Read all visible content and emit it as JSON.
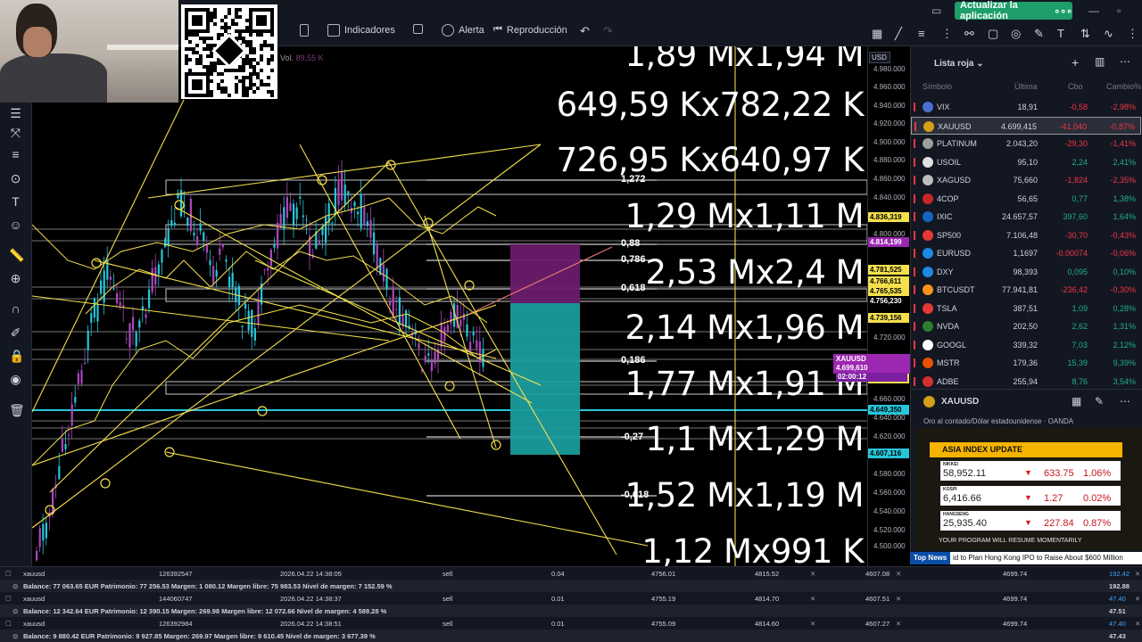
{
  "toolbar": {
    "indicators_label": "Indicadores",
    "alert_label": "Alerta",
    "replay_label": "Reproducción",
    "update_app_label": "Actualizar la aplicación"
  },
  "chart": {
    "volume_label": "Vol.",
    "volume_value": "89,55 K",
    "currency": "USD",
    "ratio_labels": [
      "1,89 Mx1,94 M",
      "649,59 Kx782,22 K",
      "726,95 Kx640,97 K",
      "1,29 Mx1,11 M",
      "2,53 Mx2,4 M",
      "2,14 Mx1,96 M",
      "1,77 Mx1,91 M",
      "1,1 Mx1,29 M",
      "1,52 Mx1,19 M",
      "1,12 Mx991 K"
    ],
    "fib_levels": [
      "1,272",
      "0,88",
      "0,786",
      "0,618",
      "0,186",
      "-0,27",
      "-0,618"
    ],
    "price_ticks": [
      "4.980.000",
      "4.960.000",
      "4.940.000",
      "4.920.000",
      "4.900.000",
      "4.880.000",
      "4.860.000",
      "4.840.000",
      "4.800.000",
      "4.720.000",
      "4.680.000",
      "4.660.000",
      "4.640.000",
      "4.620.000",
      "4.600.000",
      "4.580.000",
      "4.560.000",
      "4.540.000",
      "4.520.000",
      "4.500.000"
    ],
    "price_tags": [
      "4.836,319",
      "4.814,199",
      "4.781,525",
      "4.766,611",
      "4.765,535",
      "4.756,230",
      "4.739,156",
      "4.694,750",
      "4.649,350",
      "4.607,116"
    ],
    "current": {
      "symbol": "XAUUSD",
      "price": "4.699,610",
      "countdown": "02:00:12"
    }
  },
  "watchlist": {
    "title": "Lista roja",
    "columns": {
      "symbol": "Símbolo",
      "last": "Última",
      "change": "Cbo",
      "change_pct": "Cambio%"
    },
    "rows": [
      {
        "symbol": "VIX",
        "last": "18,91",
        "change": "-0,58",
        "pct": "-2,98%",
        "dir": "neg",
        "icon": "#4a6fd1"
      },
      {
        "symbol": "XAUUSD",
        "last": "4.699,415",
        "change": "-41,040",
        "pct": "-0,87%",
        "dir": "neg",
        "icon": "#d4a017"
      },
      {
        "symbol": "PLATINUM",
        "last": "2.043,20",
        "change": "-29,30",
        "pct": "-1,41%",
        "dir": "neg",
        "icon": "#9e9e9e"
      },
      {
        "symbol": "USOIL",
        "last": "95,10",
        "change": "2,24",
        "pct": "2,41%",
        "dir": "pos",
        "icon": "#e0e0e0"
      },
      {
        "symbol": "XAGUSD",
        "last": "75,660",
        "change": "-1,824",
        "pct": "-2,35%",
        "dir": "neg",
        "icon": "#bdbdbd"
      },
      {
        "symbol": "4COP",
        "last": "56,65",
        "change": "0,77",
        "pct": "1,38%",
        "dir": "pos",
        "icon": "#c62828"
      },
      {
        "symbol": "IXIC",
        "last": "24.657,57",
        "change": "397,60",
        "pct": "1,64%",
        "dir": "pos",
        "icon": "#1565c0"
      },
      {
        "symbol": "SP500",
        "last": "7.106,48",
        "change": "-30,70",
        "pct": "-0,43%",
        "dir": "neg",
        "icon": "#e53935"
      },
      {
        "symbol": "EURUSD",
        "last": "1,1697",
        "change": "-0,00074",
        "pct": "-0,06%",
        "dir": "neg",
        "icon": "#1e88e5"
      },
      {
        "symbol": "DXY",
        "last": "98,393",
        "change": "0,095",
        "pct": "0,10%",
        "dir": "pos",
        "icon": "#1e88e5"
      },
      {
        "symbol": "BTCUSDT",
        "last": "77.941,81",
        "change": "-236,42",
        "pct": "-0,30%",
        "dir": "neg",
        "icon": "#f7931a"
      },
      {
        "symbol": "TSLA",
        "last": "387,51",
        "change": "1,09",
        "pct": "0,28%",
        "dir": "pos",
        "icon": "#e53935"
      },
      {
        "symbol": "NVDA",
        "last": "202,50",
        "change": "2,62",
        "pct": "1,31%",
        "dir": "pos",
        "icon": "#2e7d32"
      },
      {
        "symbol": "GOOGL",
        "last": "339,32",
        "change": "7,03",
        "pct": "2,12%",
        "dir": "pos",
        "icon": "#ffffff"
      },
      {
        "symbol": "MSTR",
        "last": "179,36",
        "change": "15,39",
        "pct": "9,39%",
        "dir": "pos",
        "icon": "#e65100"
      },
      {
        "symbol": "ADBE",
        "last": "255,94",
        "change": "8,76",
        "pct": "3,54%",
        "dir": "pos",
        "icon": "#d32f2f"
      }
    ]
  },
  "details": {
    "symbol": "XAUUSD",
    "description": "Oro al contado/Dólar estadounidense · OANDA"
  },
  "overlay": {
    "title": "ASIA INDEX UPDATE",
    "indices": [
      {
        "name": "NIKKEI",
        "value": "58,952.11",
        "change": "633.75",
        "pct": "1.06%"
      },
      {
        "name": "KOSPI",
        "value": "6,416.66",
        "change": "1.27",
        "pct": "0.02%"
      },
      {
        "name": "HANGSENG",
        "value": "25,935.40",
        "change": "227.84",
        "pct": "0.87%"
      }
    ],
    "footer": "YOUR PROGRAM WILL RESUME MOMENTARILY",
    "ticker_label": "Top News",
    "ticker_text": "id to Plan Hong Kong IPO to Raise About $600 Million"
  },
  "trades": [
    {
      "symbol": "xauusd",
      "id": "126392547",
      "time": "2026.04.22 14:38:05",
      "side": "sell",
      "volume": "0.04",
      "open": "4756.01",
      "sl": "4815.52",
      "tp": "4607.08",
      "price": "4699.74",
      "profit": "192.42",
      "balance": "Balance: 77 063.65 EUR  Patrimonio: 77 256.53  Margen: 1 080.12  Margen libre: 75 983.53  Nivel de margen: 7 152.59 %",
      "balance_profit": "192.88"
    },
    {
      "symbol": "xauusd",
      "id": "144060747",
      "time": "2026.04.22 14:38:37",
      "side": "sell",
      "volume": "0.01",
      "open": "4755.19",
      "sl": "4814.70",
      "tp": "4607.51",
      "price": "4699.74",
      "profit": "47.40",
      "balance": "Balance: 12 342.64 EUR  Patrimonio: 12 390.15  Margen: 269.98  Margen libre: 12 072.66  Nivel de margen: 4 589.28 %",
      "balance_profit": "47.51"
    },
    {
      "symbol": "xauusd",
      "id": "126392984",
      "time": "2026.04.22 14:38:51",
      "side": "sell",
      "volume": "0.01",
      "open": "4755.09",
      "sl": "4814.60",
      "tp": "4607.27",
      "price": "4699.74",
      "profit": "47.40",
      "balance": "Balance: 9 880.42 EUR  Patrimonio: 9 927.85  Margen: 269.97  Margen libre: 9 610.45  Nivel de margen: 3 677.39 %",
      "balance_profit": "47.43"
    }
  ]
}
